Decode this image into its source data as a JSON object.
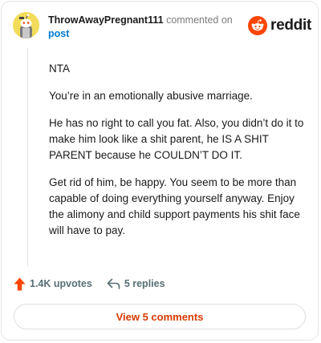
{
  "header": {
    "username": "ThrowAwayPregnant111",
    "commented_on": "commented on",
    "post_link": "post",
    "brand": "reddit",
    "avatar_icon": "snoo-avatar-icon",
    "logo_icon": "reddit-snoo-icon"
  },
  "comment": {
    "paragraphs": [
      "NTA",
      "You’re in an emotionally abusive marriage.",
      "He has no right to call you fat. Also, you didn’t do it to make him look like a shit parent, he IS A SHIT PARENT because he COULDN’T DO IT.",
      "Get rid of him, be happy. You seem to be more than capable of doing everything yourself anyway. Enjoy the alimony and child support payments his shit face will have to pay."
    ]
  },
  "actions": {
    "upvotes": "1.4K upvotes",
    "replies": "5 replies",
    "upvote_icon": "upvote-arrow-icon",
    "reply_icon": "reply-arrow-icon"
  },
  "view_button": "View 5 comments",
  "colors": {
    "brand_orange": "#ff4500",
    "link_blue": "#0079d3",
    "view_button_text": "#d93a00",
    "avatar_bg": "#f2dc5a"
  }
}
